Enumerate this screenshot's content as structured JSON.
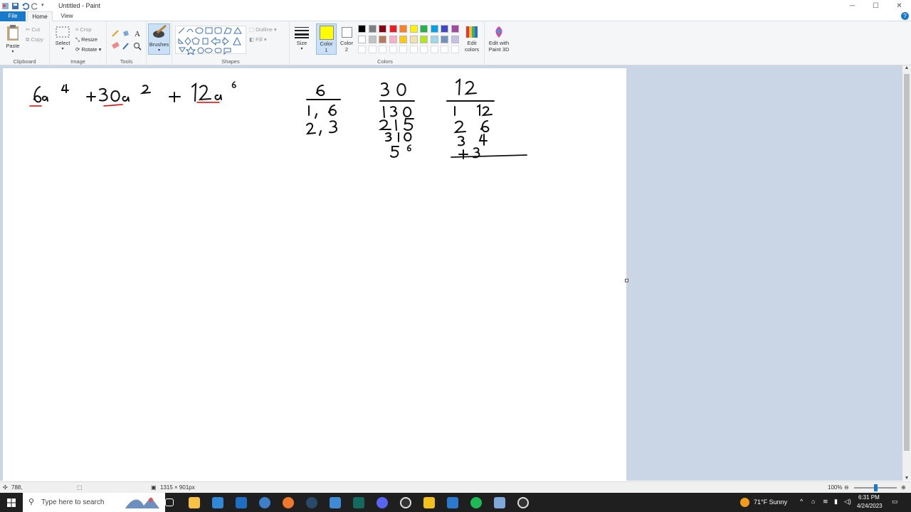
{
  "window": {
    "title": "Untitled - Paint"
  },
  "tabs": {
    "file": "File",
    "home": "Home",
    "view": "View"
  },
  "clipboard": {
    "paste": "Paste",
    "cut": "Cut",
    "copy": "Copy",
    "label": "Clipboard"
  },
  "image": {
    "select": "Select",
    "crop": "Crop",
    "resize": "Resize",
    "rotate": "Rotate",
    "label": "Image"
  },
  "tools": {
    "label": "Tools"
  },
  "brushes": {
    "label": "Brushes"
  },
  "shapes": {
    "outline": "Outline",
    "fill": "Fill",
    "label": "Shapes"
  },
  "size": {
    "label": "Size"
  },
  "colors": {
    "color1_label": "Color",
    "color1_sub": "1",
    "color2_label": "Color",
    "color2_sub": "2",
    "edit_label": "Edit",
    "edit_sub": "colors",
    "paint3d_label": "Edit with",
    "paint3d_sub": "Paint 3D",
    "label": "Colors",
    "color1": "#ffff00",
    "color2": "#ffffff",
    "palette": [
      "#000000",
      "#7f7f7f",
      "#880015",
      "#ed1c24",
      "#ff7f27",
      "#fff200",
      "#22b14c",
      "#00a2e8",
      "#3f48cc",
      "#a349a4",
      "#ffffff",
      "#c3c3c3",
      "#b97a57",
      "#ffaec9",
      "#ffc90e",
      "#efe4b0",
      "#b5e61d",
      "#99d9ea",
      "#7092be",
      "#c8bfe7"
    ]
  },
  "status": {
    "cursor_pos": "788,",
    "canvas_size": "1315 × 901px",
    "zoom": "100%"
  },
  "taskbar": {
    "search_placeholder": "Type here to search",
    "weather": "71°F  Sunny",
    "time": "6:31 PM",
    "date": "4/24/2023"
  },
  "drawing": {
    "expression": "6a⁴ + 30a² + 12a⁶",
    "col1": [
      "6",
      "1, 6",
      "2, 3"
    ],
    "col2": [
      "30",
      "1 30",
      "2 15",
      "3 10",
      "5 6"
    ],
    "col3": [
      "12",
      "1  12",
      "2  6",
      "3  4",
      "+3"
    ]
  }
}
